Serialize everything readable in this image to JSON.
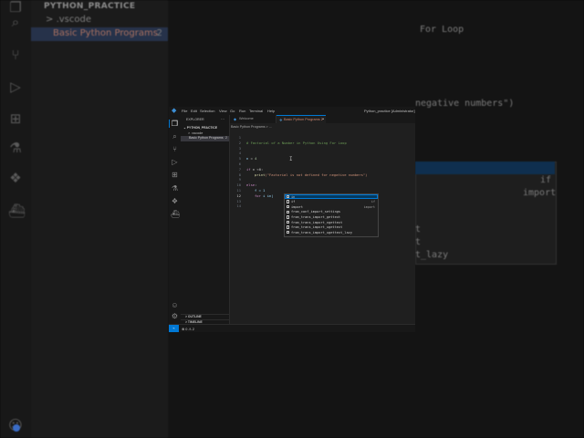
{
  "background": {
    "sidebar_title": "PYTHON_PRACTICE",
    "folder": ".vscode",
    "file": "Basic Python Programs",
    "file_count": "2",
    "code_fragments": [
      "For Loop",
      "negative numbers\")",
      "if",
      "import",
      "t",
      "t",
      "t_lazy"
    ]
  },
  "window": {
    "menu": [
      "File",
      "Edit",
      "Selection",
      "View",
      "Go",
      "Run",
      "Terminal",
      "Help"
    ],
    "title": "Python_practice [Administrator]"
  },
  "sidebar": {
    "header": "EXPLORER",
    "more": "···",
    "project": "PYTHON_PRACTICE",
    "folder": "> .vscode",
    "file": "Basic Python Programs",
    "file_count": "2",
    "outline": "> OUTLINE",
    "timeline": "> TIMELINE"
  },
  "tabs": {
    "welcome": "Welcome",
    "active": "Basic Python Programs 2"
  },
  "breadcrumb": "Basic Python Programs > ...",
  "editor": {
    "line_numbers": [
      "1",
      "2",
      "3",
      "4",
      "5",
      "6",
      "7",
      "8",
      "9",
      "10",
      "11",
      "12",
      "13",
      "14"
    ],
    "lines": {
      "l2": "# Factorial of a Number in Python Using For Loop",
      "l5_var": "n",
      "l5_op": " = ",
      "l5_val": "4",
      "l7_kw": "if",
      "l7_rest": " n <0:",
      "l8_fn": "print",
      "l8_str": "(\"Factorial is not defined for negative numbers\")",
      "l10_kw": "else",
      "l10_rest": ":",
      "l11": "f = 1",
      "l12_kw": "for",
      "l12_rest": " i in|"
    },
    "suggestions": [
      {
        "label": "in",
        "detail": ""
      },
      {
        "label": "if",
        "detail": "if"
      },
      {
        "label": "import",
        "detail": "import"
      },
      {
        "label": "from_conf_import_settings",
        "detail": ""
      },
      {
        "label": "from_trans_import_gettext",
        "detail": ""
      },
      {
        "label": "from_trans_import_ngettext",
        "detail": ""
      },
      {
        "label": "from_trans_import_ugettext",
        "detail": ""
      },
      {
        "label": "from_trans_import_ugettext_lazy",
        "detail": ""
      }
    ]
  },
  "status": {
    "remote": "⌁",
    "problems": "⊗ 0 ⚠ 2"
  }
}
